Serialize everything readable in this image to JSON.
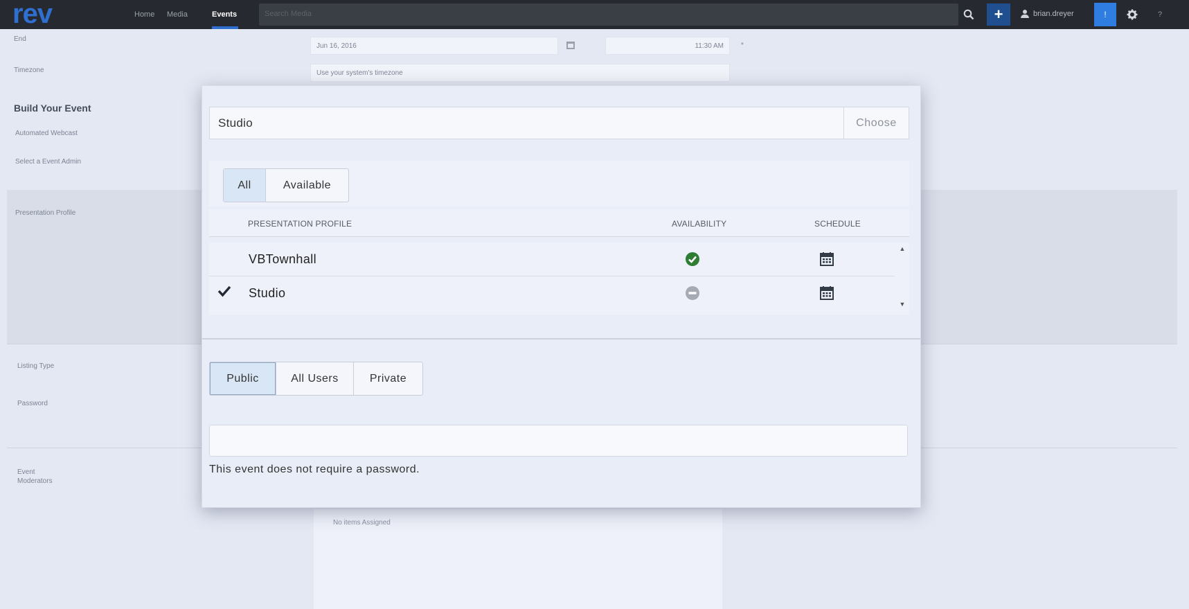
{
  "app": {
    "logo": "rev",
    "nav": [
      {
        "label": "Home"
      },
      {
        "label": "Media"
      },
      {
        "label": "Events"
      }
    ],
    "search_placeholder": "Search Media",
    "username": "brian.dreyer",
    "notification_label": "!",
    "help_label": "?",
    "accent_color": "#2f6fd0"
  },
  "background_form": {
    "end_label": "End",
    "end_date": "Jun 16, 2016",
    "end_time": "11:30 AM",
    "required_mark": "*",
    "timezone_label": "Timezone",
    "timezone_value": "Use your system's timezone",
    "build_heading": "Build Your Event",
    "automated_webcast_label": "Automated Webcast",
    "event_admin_label": "Select a Event Admin",
    "presentation_profile_label": "Presentation Profile",
    "listing_type_label": "Listing Type",
    "password_label": "Password",
    "event_moderators_label_1": "Event",
    "event_moderators_label_2": "Moderators",
    "no_items_text": "No items Assigned"
  },
  "modal": {
    "selected_profile": "Studio",
    "choose_label": "Choose",
    "filters": [
      {
        "label": "All",
        "active": true
      },
      {
        "label": "Available",
        "active": false
      }
    ],
    "columns": {
      "profile": "PRESENTATION PROFILE",
      "availability": "AVAILABILITY",
      "schedule": "SCHEDULE"
    },
    "rows": [
      {
        "name": "VBTownhall",
        "selected": false,
        "availability": "available",
        "availability_icon": "green-check-circle-icon",
        "schedule_icon": "calendar-icon"
      },
      {
        "name": "Studio",
        "selected": true,
        "availability": "unavailable",
        "availability_icon": "gray-minus-circle-icon",
        "schedule_icon": "calendar-icon"
      }
    ],
    "listing_types": [
      {
        "label": "Public",
        "active": true
      },
      {
        "label": "All Users",
        "active": false
      },
      {
        "label": "Private",
        "active": false
      }
    ],
    "password_value": "",
    "password_help": "This event does not require a password.",
    "available_color": "#2e7d32",
    "unavailable_color": "#a6abb3"
  }
}
